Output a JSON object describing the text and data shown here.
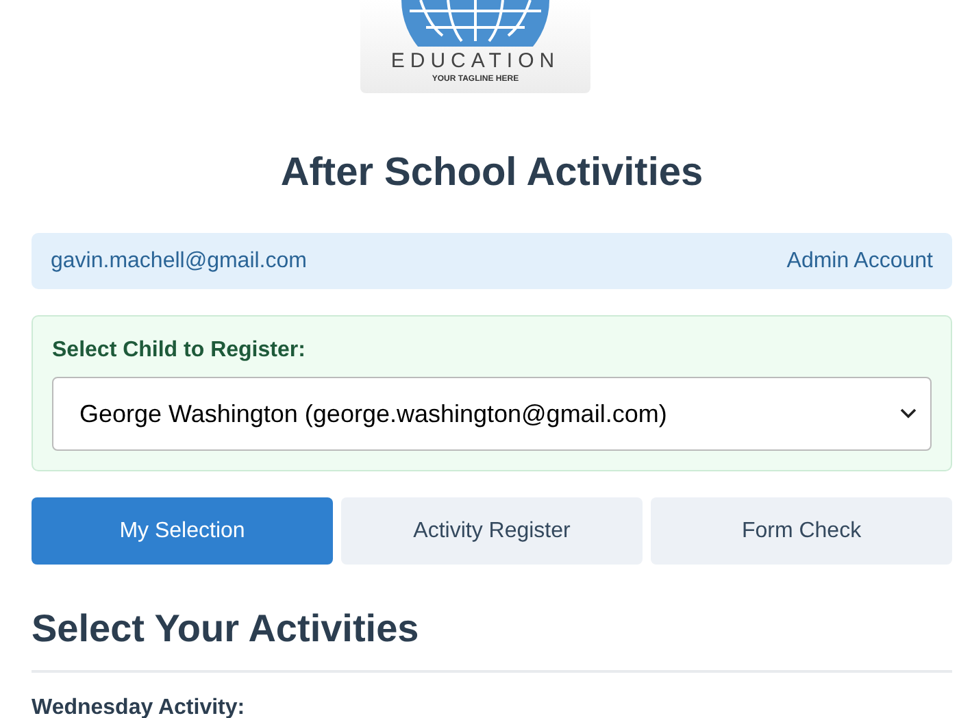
{
  "logo": {
    "wordmark": "EDUCATION",
    "tagline": "YOUR TAGLINE HERE"
  },
  "title": "After School Activities",
  "account": {
    "email": "gavin.machell@gmail.com",
    "role": "Admin Account"
  },
  "child_select": {
    "label": "Select Child to Register:",
    "value": "George Washington (george.washington@gmail.com)"
  },
  "tabs": [
    {
      "label": "My Selection",
      "selected": true
    },
    {
      "label": "Activity Register",
      "selected": false
    },
    {
      "label": "Form Check",
      "selected": false
    }
  ],
  "section": {
    "heading": "Select Your Activities",
    "subheading": "Wednesday Activity:"
  }
}
